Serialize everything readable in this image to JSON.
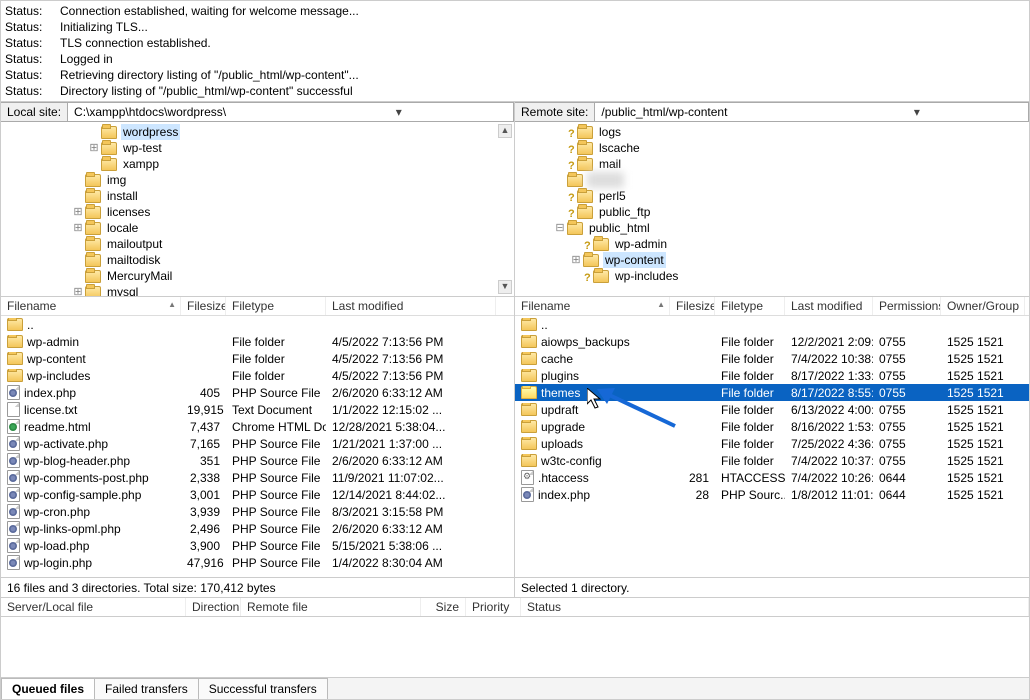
{
  "log": [
    {
      "label": "Status:",
      "msg": "Connection established, waiting for welcome message..."
    },
    {
      "label": "Status:",
      "msg": "Initializing TLS..."
    },
    {
      "label": "Status:",
      "msg": "TLS connection established."
    },
    {
      "label": "Status:",
      "msg": "Logged in"
    },
    {
      "label": "Status:",
      "msg": "Retrieving directory listing of \"/public_html/wp-content\"..."
    },
    {
      "label": "Status:",
      "msg": "Directory listing of \"/public_html/wp-content\" successful"
    }
  ],
  "local": {
    "site_label": "Local site:",
    "path": "C:\\xampp\\htdocs\\wordpress\\",
    "tree": [
      {
        "indent": 5,
        "tw": "",
        "name": "wordpress",
        "sel": true
      },
      {
        "indent": 5,
        "tw": "⊞",
        "name": "wp-test"
      },
      {
        "indent": 5,
        "tw": "",
        "name": "xampp"
      },
      {
        "indent": 4,
        "tw": "",
        "name": "img"
      },
      {
        "indent": 4,
        "tw": "",
        "name": "install"
      },
      {
        "indent": 4,
        "tw": "⊞",
        "name": "licenses"
      },
      {
        "indent": 4,
        "tw": "⊞",
        "name": "locale"
      },
      {
        "indent": 4,
        "tw": "",
        "name": "mailoutput"
      },
      {
        "indent": 4,
        "tw": "",
        "name": "mailtodisk"
      },
      {
        "indent": 4,
        "tw": "",
        "name": "MercuryMail"
      },
      {
        "indent": 4,
        "tw": "⊞",
        "name": "mysql"
      }
    ],
    "columns": {
      "fn": "Filename",
      "sz": "Filesize",
      "tp": "Filetype",
      "lm": "Last modified"
    },
    "files": [
      {
        "icon": "folder",
        "name": "..",
        "size": "",
        "type": "",
        "lm": ""
      },
      {
        "icon": "folder",
        "name": "wp-admin",
        "size": "",
        "type": "File folder",
        "lm": "4/5/2022 7:13:56 PM"
      },
      {
        "icon": "folder",
        "name": "wp-content",
        "size": "",
        "type": "File folder",
        "lm": "4/5/2022 7:13:56 PM"
      },
      {
        "icon": "folder",
        "name": "wp-includes",
        "size": "",
        "type": "File folder",
        "lm": "4/5/2022 7:13:56 PM"
      },
      {
        "icon": "php",
        "name": "index.php",
        "size": "405",
        "type": "PHP Source File",
        "lm": "2/6/2020 6:33:12 AM"
      },
      {
        "icon": "file",
        "name": "license.txt",
        "size": "19,915",
        "type": "Text Document",
        "lm": "1/1/2022 12:15:02 ..."
      },
      {
        "icon": "html",
        "name": "readme.html",
        "size": "7,437",
        "type": "Chrome HTML Do...",
        "lm": "12/28/2021 5:38:04..."
      },
      {
        "icon": "php",
        "name": "wp-activate.php",
        "size": "7,165",
        "type": "PHP Source File",
        "lm": "1/21/2021 1:37:00 ..."
      },
      {
        "icon": "php",
        "name": "wp-blog-header.php",
        "size": "351",
        "type": "PHP Source File",
        "lm": "2/6/2020 6:33:12 AM"
      },
      {
        "icon": "php",
        "name": "wp-comments-post.php",
        "size": "2,338",
        "type": "PHP Source File",
        "lm": "11/9/2021 11:07:02..."
      },
      {
        "icon": "php",
        "name": "wp-config-sample.php",
        "size": "3,001",
        "type": "PHP Source File",
        "lm": "12/14/2021 8:44:02..."
      },
      {
        "icon": "php",
        "name": "wp-cron.php",
        "size": "3,939",
        "type": "PHP Source File",
        "lm": "8/3/2021 3:15:58 PM"
      },
      {
        "icon": "php",
        "name": "wp-links-opml.php",
        "size": "2,496",
        "type": "PHP Source File",
        "lm": "2/6/2020 6:33:12 AM"
      },
      {
        "icon": "php",
        "name": "wp-load.php",
        "size": "3,900",
        "type": "PHP Source File",
        "lm": "5/15/2021 5:38:06 ..."
      },
      {
        "icon": "php",
        "name": "wp-login.php",
        "size": "47,916",
        "type": "PHP Source File",
        "lm": "1/4/2022 8:30:04 AM"
      }
    ],
    "status": "16 files and 3 directories. Total size: 170,412 bytes"
  },
  "remote": {
    "site_label": "Remote site:",
    "path": "/public_html/wp-content",
    "tree": [
      {
        "indent": 2,
        "tw": "",
        "q": true,
        "name": "logs"
      },
      {
        "indent": 2,
        "tw": "",
        "q": true,
        "name": "lscache"
      },
      {
        "indent": 2,
        "tw": "",
        "q": true,
        "name": "mail"
      },
      {
        "indent": 2,
        "tw": "",
        "q": false,
        "name": "",
        "blur": true
      },
      {
        "indent": 2,
        "tw": "",
        "q": true,
        "name": "perl5"
      },
      {
        "indent": 2,
        "tw": "",
        "q": true,
        "name": "public_ftp"
      },
      {
        "indent": 2,
        "tw": "⊟",
        "q": false,
        "name": "public_html"
      },
      {
        "indent": 3,
        "tw": "",
        "q": true,
        "name": "wp-admin"
      },
      {
        "indent": 3,
        "tw": "⊞",
        "q": false,
        "name": "wp-content",
        "sel": true
      },
      {
        "indent": 3,
        "tw": "",
        "q": true,
        "name": "wp-includes"
      }
    ],
    "columns": {
      "fn": "Filename",
      "sz": "Filesize",
      "tp": "Filetype",
      "lm": "Last modified",
      "pm": "Permissions",
      "og": "Owner/Group"
    },
    "files": [
      {
        "icon": "folder",
        "name": "..",
        "size": "",
        "type": "",
        "lm": "",
        "pm": "",
        "og": ""
      },
      {
        "icon": "folder",
        "name": "aiowps_backups",
        "size": "",
        "type": "File folder",
        "lm": "12/2/2021 2:09:...",
        "pm": "0755",
        "og": "1525 1521"
      },
      {
        "icon": "folder",
        "name": "cache",
        "size": "",
        "type": "File folder",
        "lm": "7/4/2022 10:38:...",
        "pm": "0755",
        "og": "1525 1521"
      },
      {
        "icon": "folder",
        "name": "plugins",
        "size": "",
        "type": "File folder",
        "lm": "8/17/2022 1:33:...",
        "pm": "0755",
        "og": "1525 1521"
      },
      {
        "icon": "folder",
        "name": "themes",
        "size": "",
        "type": "File folder",
        "lm": "8/17/2022 8:55:...",
        "pm": "0755",
        "og": "1525 1521",
        "sel": true
      },
      {
        "icon": "folder",
        "name": "updraft",
        "size": "",
        "type": "File folder",
        "lm": "6/13/2022 4:00:...",
        "pm": "0755",
        "og": "1525 1521"
      },
      {
        "icon": "folder",
        "name": "upgrade",
        "size": "",
        "type": "File folder",
        "lm": "8/16/2022 1:53:...",
        "pm": "0755",
        "og": "1525 1521"
      },
      {
        "icon": "folder",
        "name": "uploads",
        "size": "",
        "type": "File folder",
        "lm": "7/25/2022 4:36:...",
        "pm": "0755",
        "og": "1525 1521"
      },
      {
        "icon": "folder",
        "name": "w3tc-config",
        "size": "",
        "type": "File folder",
        "lm": "7/4/2022 10:37:...",
        "pm": "0755",
        "og": "1525 1521"
      },
      {
        "icon": "gear",
        "name": ".htaccess",
        "size": "281",
        "type": "HTACCESS ...",
        "lm": "7/4/2022 10:26:...",
        "pm": "0644",
        "og": "1525 1521"
      },
      {
        "icon": "php",
        "name": "index.php",
        "size": "28",
        "type": "PHP Sourc...",
        "lm": "1/8/2012 11:01:...",
        "pm": "0644",
        "og": "1525 1521"
      }
    ],
    "status": "Selected 1 directory."
  },
  "queue": {
    "cols": {
      "sl": "Server/Local file",
      "dir": "Direction",
      "rf": "Remote file",
      "sz": "Size",
      "pr": "Priority",
      "st": "Status"
    }
  },
  "tabs": {
    "queued": "Queued files",
    "failed": "Failed transfers",
    "ok": "Successful transfers"
  }
}
